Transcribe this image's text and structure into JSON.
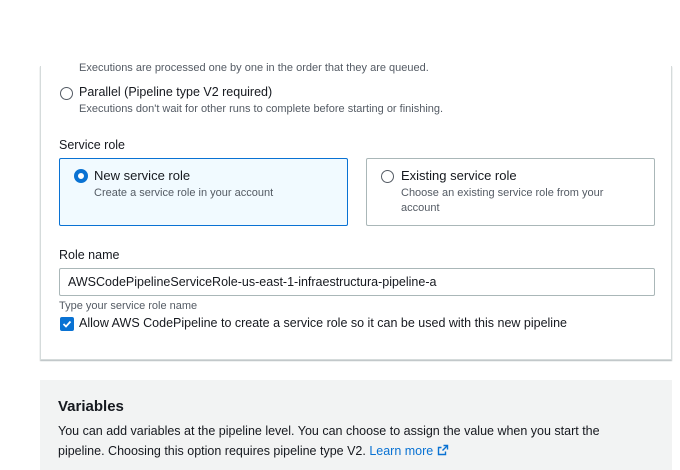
{
  "execution_mode": {
    "queued_description": "Executions are processed one by one in the order that they are queued.",
    "parallel_label": "Parallel (Pipeline type V2 required)",
    "parallel_description": "Executions don't wait for other runs to complete before starting or finishing."
  },
  "service_role": {
    "heading": "Service role",
    "new_role": {
      "title": "New service role",
      "description": "Create a service role in your account",
      "selected": true
    },
    "existing_role": {
      "title": "Existing service role",
      "description_line1": "Choose an existing service role from your",
      "description_line2": "account",
      "selected": false
    }
  },
  "role_name": {
    "label": "Role name",
    "value": "AWSCodePipelineServiceRole-us-east-1-infraestructura-pipeline-a",
    "hint": "Type your service role name"
  },
  "allow_checkbox": {
    "label": "Allow AWS CodePipeline to create a service role so it can be used with this new pipeline",
    "checked": true
  },
  "variables": {
    "title": "Variables",
    "description_line1": "You can add variables at the pipeline level. You can choose to assign the value when you start the",
    "description_line2": "pipeline. Choosing this option requires pipeline type V2.",
    "learn_more": "Learn more"
  },
  "colors": {
    "accent": "#0972d3",
    "selected_card_bg": "#f1faff",
    "section_bg": "#f2f3f3"
  },
  "icons": {
    "checkbox_checked": "check-icon",
    "external_link": "external-link-icon"
  }
}
